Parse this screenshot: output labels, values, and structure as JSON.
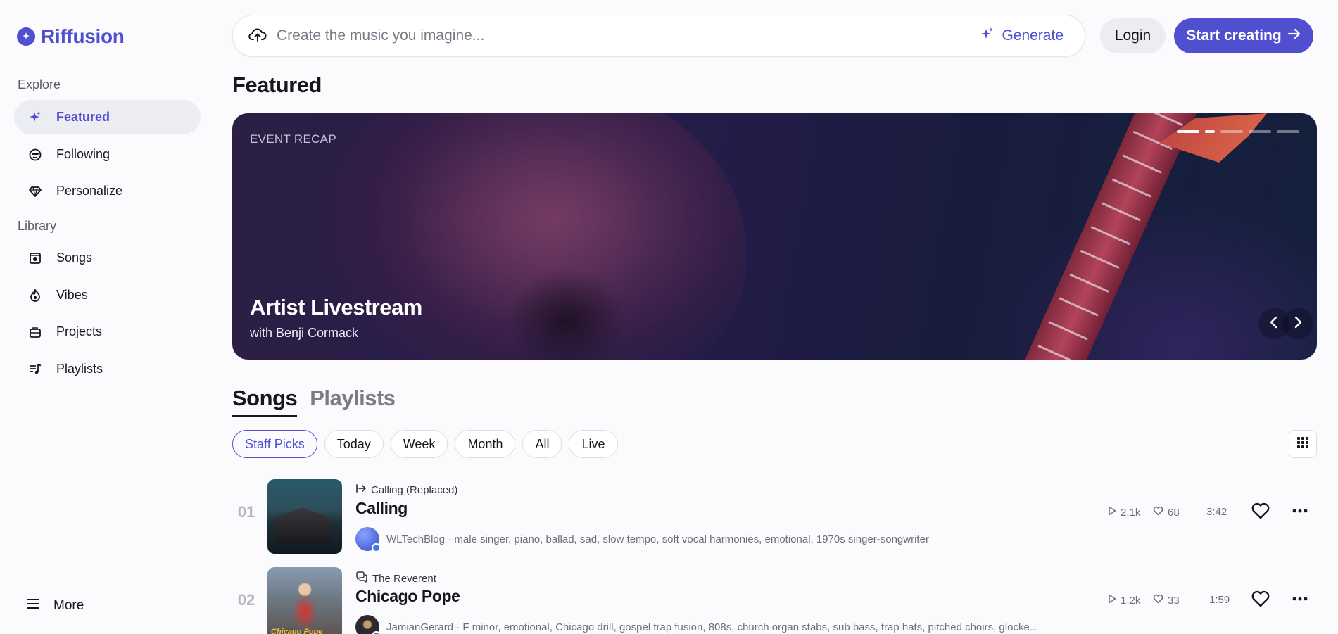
{
  "app": {
    "name": "Riffusion"
  },
  "sidebar": {
    "explore_label": "Explore",
    "library_label": "Library",
    "explore_items": [
      {
        "label": "Featured",
        "icon": "sparkle-icon",
        "active": true
      },
      {
        "label": "Following",
        "icon": "smiley-icon"
      },
      {
        "label": "Personalize",
        "icon": "diamond-icon"
      }
    ],
    "library_items": [
      {
        "label": "Songs",
        "icon": "record-icon"
      },
      {
        "label": "Vibes",
        "icon": "flame-icon"
      },
      {
        "label": "Projects",
        "icon": "briefcase-icon"
      },
      {
        "label": "Playlists",
        "icon": "playlist-icon"
      }
    ],
    "more_label": "More"
  },
  "header": {
    "search_placeholder": "Create the music you imagine...",
    "generate_label": "Generate",
    "login_label": "Login",
    "start_label": "Start creating"
  },
  "featured": {
    "section_title": "Featured",
    "hero": {
      "tag": "EVENT RECAP",
      "title": "Artist Livestream",
      "subtitle": "with Benji Cormack",
      "slide_count": 5,
      "active_slide": 2
    }
  },
  "tabs": [
    {
      "label": "Songs",
      "active": true
    },
    {
      "label": "Playlists",
      "active": false
    }
  ],
  "filters": [
    "Staff Picks",
    "Today",
    "Week",
    "Month",
    "All",
    "Live"
  ],
  "active_filter": "Staff Picks",
  "songs": [
    {
      "rank": "01",
      "from": "Calling (Replaced)",
      "from_icon": "replace-icon",
      "title": "Calling",
      "meta": "WLTechBlog · male singer, piano, ballad, sad, slow tempo, soft vocal harmonies, emotional, 1970s singer-songwriter",
      "plays": "2.1k",
      "likes": "68",
      "duration": "3:42"
    },
    {
      "rank": "02",
      "from": "The Reverent",
      "from_icon": "chat-icon",
      "title": "Chicago Pope",
      "cover_text": "Chicago Pope",
      "meta": "JamianGerard · F minor, emotional, Chicago drill, gospel trap fusion, 808s, church organ stabs, sub bass, trap hats, pitched choirs, glocke...",
      "plays": "1.2k",
      "likes": "33",
      "duration": "1:59"
    }
  ],
  "colors": {
    "accent": "#4f4fd0",
    "text": "#16161d",
    "muted": "#6e6e7a"
  }
}
